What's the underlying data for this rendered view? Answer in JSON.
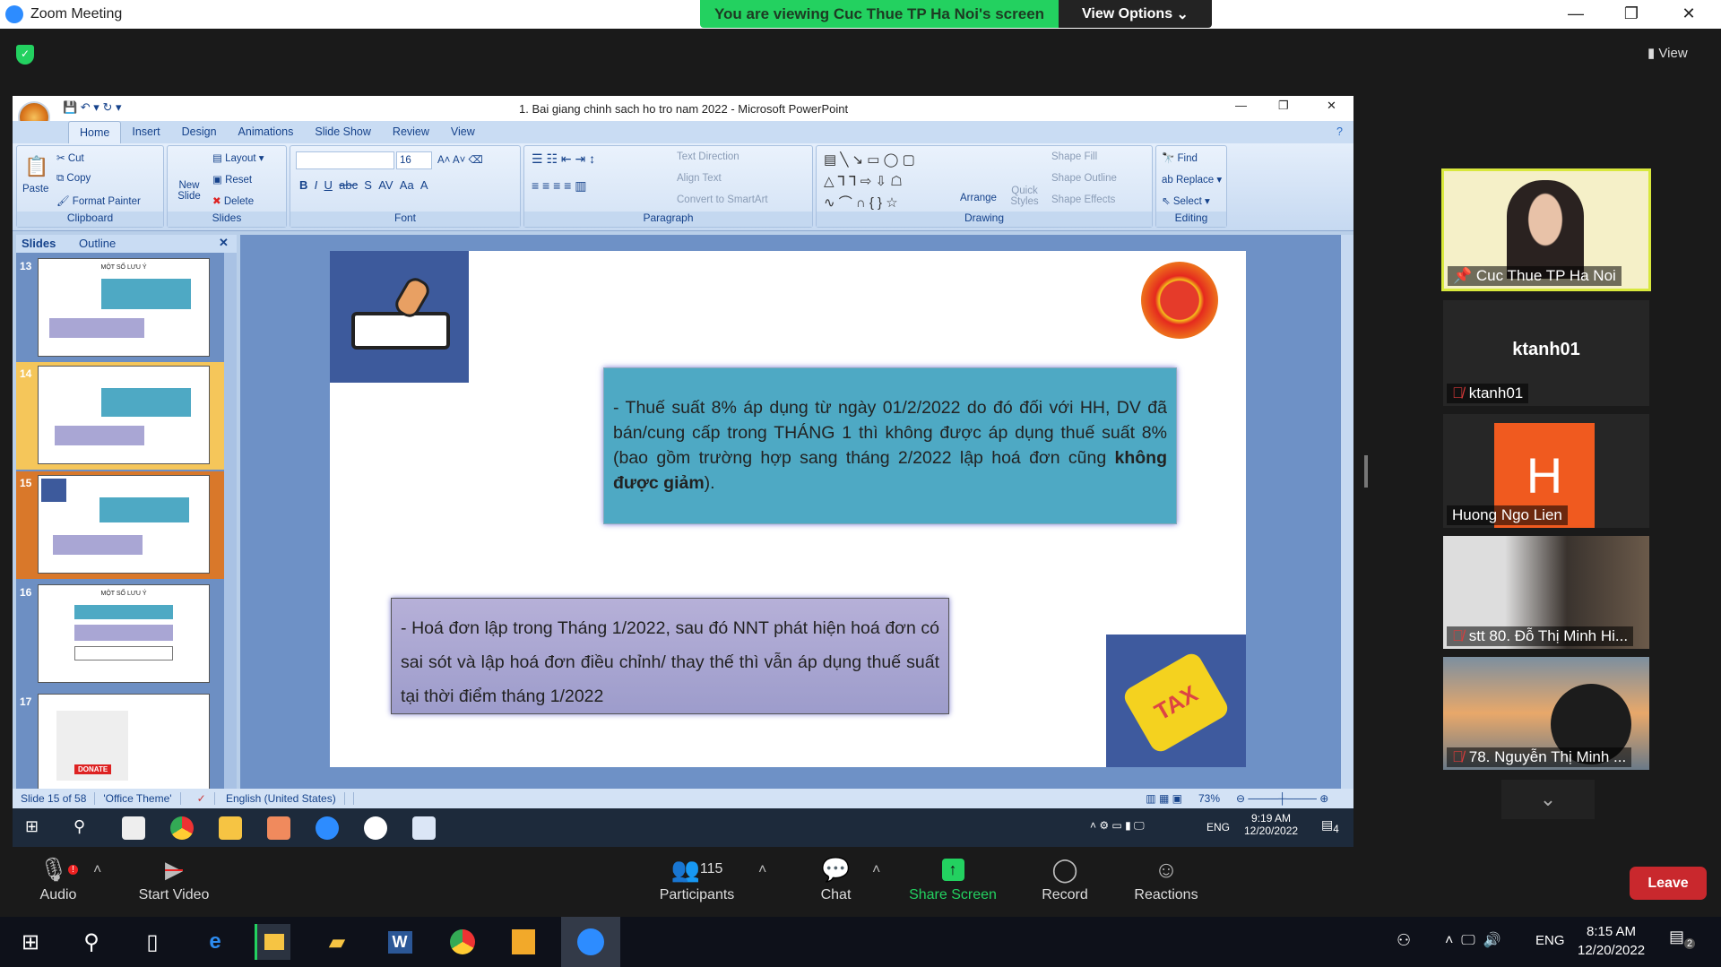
{
  "zoom": {
    "window_title": "Zoom Meeting",
    "banner": "You are viewing Cuc Thue TP Ha Noi's screen",
    "view_options": "View Options",
    "view_label": "View",
    "leave": "Leave",
    "controls": [
      {
        "label": "Audio",
        "icon": "microphone-icon"
      },
      {
        "label": "Start Video",
        "icon": "video-off-icon"
      },
      {
        "label": "Participants",
        "icon": "participants-icon",
        "count": "115"
      },
      {
        "label": "Chat",
        "icon": "chat-icon"
      },
      {
        "label": "Share Screen",
        "icon": "share-screen-icon"
      },
      {
        "label": "Record",
        "icon": "record-icon"
      },
      {
        "label": "Reactions",
        "icon": "reactions-icon"
      }
    ]
  },
  "participants": [
    {
      "name": "Cuc Thue TP Ha Noi",
      "role": "spotlight"
    },
    {
      "name": "ktanh01",
      "display": "ktanh01",
      "muted": true
    },
    {
      "name": "Huong Ngo Lien",
      "initial": "H",
      "avatar_color": "#f05a1f"
    },
    {
      "name": "stt 80. Đỗ Thị Minh Hi...",
      "muted": true
    },
    {
      "name": "78. Nguyễn Thị Minh ...",
      "muted": true
    }
  ],
  "ppt": {
    "title": "1. Bai giang chinh sach ho tro nam 2022 - Microsoft PowerPoint",
    "tabs": [
      "Home",
      "Insert",
      "Design",
      "Animations",
      "Slide Show",
      "Review",
      "View"
    ],
    "active_tab": "Home",
    "ribbon": {
      "clipboard": {
        "label": "Clipboard",
        "paste": "Paste",
        "cut": "Cut",
        "copy": "Copy",
        "format_painter": "Format Painter"
      },
      "slides": {
        "label": "Slides",
        "new_slide": "New Slide",
        "layout": "Layout",
        "reset": "Reset",
        "delete": "Delete"
      },
      "font": {
        "label": "Font",
        "size": "16"
      },
      "paragraph": {
        "label": "Paragraph",
        "text_direction": "Text Direction",
        "align_text": "Align Text",
        "convert": "Convert to SmartArt"
      },
      "drawing": {
        "label": "Drawing",
        "arrange": "Arrange",
        "quick_styles": "Quick Styles",
        "shape_fill": "Shape Fill",
        "shape_outline": "Shape Outline",
        "shape_effects": "Shape Effects"
      },
      "editing": {
        "label": "Editing",
        "find": "Find",
        "replace": "Replace",
        "select": "Select"
      }
    },
    "panel_tabs": [
      "Slides",
      "Outline"
    ],
    "thumbnails": [
      {
        "num": "13",
        "title": "MỘT SỐ LƯU Ý"
      },
      {
        "num": "14"
      },
      {
        "num": "15",
        "selected": true
      },
      {
        "num": "16",
        "title": "MỘT SỐ LƯU Ý"
      },
      {
        "num": "17",
        "badge": "DONATE"
      }
    ],
    "slide": {
      "box1": "- Thuế suất 8% áp dụng từ ngày 01/2/2022 do đó đối với HH, DV đã bán/cung cấp trong THÁNG 1 thì không được áp dụng thuế suất 8% (bao gồm trường hợp sang tháng 2/2022 lập hoá đơn cũng ",
      "box1_bold": "không được giảm",
      "box1_end": ").",
      "box2": "- Hoá đơn lập trong Tháng 1/2022, sau đó NNT phát hiện hoá đơn có sai sót và lập hoá đơn điều chỉnh/ thay thế thì vẫn áp dụng thuế suất tại thời điểm tháng 1/2022",
      "tag": "TAX"
    },
    "status": {
      "slide": "Slide 15 of 58",
      "theme": "'Office Theme'",
      "language": "English (United States)",
      "zoom": "73%"
    },
    "taskbar": {
      "time": "9:19 AM",
      "date": "12/20/2022",
      "lang": "ENG",
      "notif": "4"
    }
  },
  "windows": {
    "time": "8:15 AM",
    "date": "12/20/2022",
    "lang": "ENG",
    "notif": "2"
  }
}
